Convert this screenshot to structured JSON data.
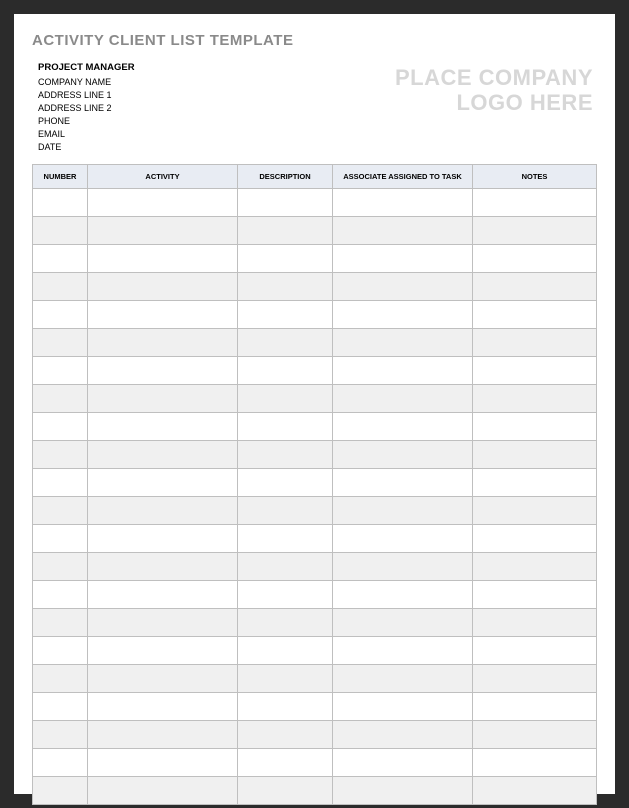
{
  "title": "ACTIVITY CLIENT LIST TEMPLATE",
  "meta": {
    "project_manager_label": "PROJECT MANAGER",
    "company_name": "COMPANY NAME",
    "address_line_1": "ADDRESS LINE 1",
    "address_line_2": "ADDRESS LINE 2",
    "phone": "PHONE",
    "email": "EMAIL",
    "date": "DATE"
  },
  "logo_placeholder": {
    "line1": "PLACE COMPANY",
    "line2": "LOGO HERE"
  },
  "table": {
    "headers": {
      "number": "NUMBER",
      "activity": "ACTIVITY",
      "description": "DESCRIPTION",
      "associate": "ASSOCIATE ASSIGNED TO TASK",
      "notes": "NOTES"
    },
    "rows": [
      {
        "number": "",
        "activity": "",
        "description": "",
        "associate": "",
        "notes": ""
      },
      {
        "number": "",
        "activity": "",
        "description": "",
        "associate": "",
        "notes": ""
      },
      {
        "number": "",
        "activity": "",
        "description": "",
        "associate": "",
        "notes": ""
      },
      {
        "number": "",
        "activity": "",
        "description": "",
        "associate": "",
        "notes": ""
      },
      {
        "number": "",
        "activity": "",
        "description": "",
        "associate": "",
        "notes": ""
      },
      {
        "number": "",
        "activity": "",
        "description": "",
        "associate": "",
        "notes": ""
      },
      {
        "number": "",
        "activity": "",
        "description": "",
        "associate": "",
        "notes": ""
      },
      {
        "number": "",
        "activity": "",
        "description": "",
        "associate": "",
        "notes": ""
      },
      {
        "number": "",
        "activity": "",
        "description": "",
        "associate": "",
        "notes": ""
      },
      {
        "number": "",
        "activity": "",
        "description": "",
        "associate": "",
        "notes": ""
      },
      {
        "number": "",
        "activity": "",
        "description": "",
        "associate": "",
        "notes": ""
      },
      {
        "number": "",
        "activity": "",
        "description": "",
        "associate": "",
        "notes": ""
      },
      {
        "number": "",
        "activity": "",
        "description": "",
        "associate": "",
        "notes": ""
      },
      {
        "number": "",
        "activity": "",
        "description": "",
        "associate": "",
        "notes": ""
      },
      {
        "number": "",
        "activity": "",
        "description": "",
        "associate": "",
        "notes": ""
      },
      {
        "number": "",
        "activity": "",
        "description": "",
        "associate": "",
        "notes": ""
      },
      {
        "number": "",
        "activity": "",
        "description": "",
        "associate": "",
        "notes": ""
      },
      {
        "number": "",
        "activity": "",
        "description": "",
        "associate": "",
        "notes": ""
      },
      {
        "number": "",
        "activity": "",
        "description": "",
        "associate": "",
        "notes": ""
      },
      {
        "number": "",
        "activity": "",
        "description": "",
        "associate": "",
        "notes": ""
      },
      {
        "number": "",
        "activity": "",
        "description": "",
        "associate": "",
        "notes": ""
      },
      {
        "number": "",
        "activity": "",
        "description": "",
        "associate": "",
        "notes": ""
      }
    ]
  }
}
